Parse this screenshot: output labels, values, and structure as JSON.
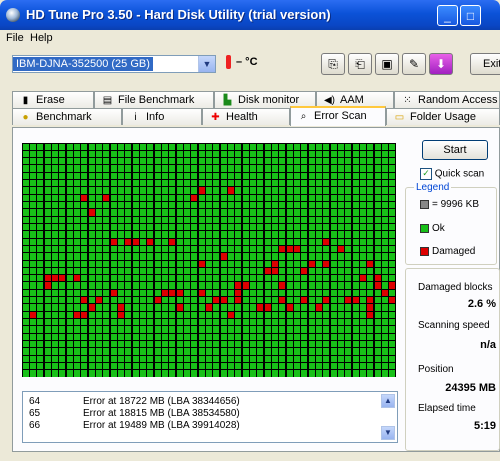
{
  "window": {
    "title": "HD Tune Pro 3.50 - Hard Disk Utility (trial version)",
    "menu": [
      "File",
      "Help"
    ]
  },
  "toolbar": {
    "drive": "IBM-DJNA-352500 (25 GB)",
    "temperature": "– °C",
    "exit_label": "Exit",
    "icons": [
      "copy-icon",
      "copy-all-icon",
      "save-icon",
      "options-icon",
      "download-icon"
    ]
  },
  "tabs_top": [
    {
      "label": "Erase",
      "icon": "trash-icon"
    },
    {
      "label": "File Benchmark",
      "icon": "file-benchmark-icon"
    },
    {
      "label": "Disk monitor",
      "icon": "disk-monitor-icon"
    },
    {
      "label": "AAM",
      "icon": "speaker-icon"
    },
    {
      "label": "Random Access",
      "icon": "random-access-icon"
    }
  ],
  "tabs_bottom": [
    {
      "label": "Benchmark",
      "icon": "benchmark-icon"
    },
    {
      "label": "Info",
      "icon": "info-icon"
    },
    {
      "label": "Health",
      "icon": "health-cross-icon"
    },
    {
      "label": "Error Scan",
      "icon": "magnifier-icon",
      "active": true
    },
    {
      "label": "Folder Usage",
      "icon": "folder-icon"
    }
  ],
  "controls": {
    "start_label": "Start",
    "quick_scan_label": "Quick scan",
    "quick_scan_checked": true
  },
  "legend": {
    "title": "Legend",
    "block_size": "= 9996 KB",
    "ok_label": "Ok",
    "damaged_label": "Damaged",
    "ok_color": "#18c018",
    "damaged_color": "#dd0000"
  },
  "stats": {
    "damaged_blocks_label": "Damaged blocks",
    "damaged_blocks_value": "2.6 %",
    "scanning_speed_label": "Scanning speed",
    "scanning_speed_value": "n/a",
    "position_label": "Position",
    "position_value": "24395 MB",
    "elapsed_label": "Elapsed time",
    "elapsed_value": "5:19"
  },
  "log": [
    {
      "num": "64",
      "text": "Error at 18722 MB (LBA 38344656)"
    },
    {
      "num": "65",
      "text": "Error at 18815 MB (LBA 38534580)"
    },
    {
      "num": "66",
      "text": "Error at 19489 MB (LBA 39914028)"
    }
  ],
  "scan_grid": {
    "cols": 51,
    "rows": 32,
    "damaged": [
      [
        11,
        7
      ],
      [
        9,
        9
      ],
      [
        24,
        6
      ],
      [
        8,
        7
      ],
      [
        23,
        7
      ],
      [
        28,
        6
      ],
      [
        12,
        13
      ],
      [
        14,
        13
      ],
      [
        15,
        13
      ],
      [
        17,
        13
      ],
      [
        20,
        13
      ],
      [
        41,
        13
      ],
      [
        35,
        14
      ],
      [
        36,
        14
      ],
      [
        37,
        14
      ],
      [
        43,
        14
      ],
      [
        47,
        16
      ],
      [
        41,
        16
      ],
      [
        33,
        17
      ],
      [
        34,
        17
      ],
      [
        38,
        17
      ],
      [
        39,
        16
      ],
      [
        24,
        16
      ],
      [
        27,
        15
      ],
      [
        3,
        18
      ],
      [
        4,
        18
      ],
      [
        5,
        18
      ],
      [
        7,
        18
      ],
      [
        3,
        19
      ],
      [
        29,
        19
      ],
      [
        30,
        19
      ],
      [
        48,
        19
      ],
      [
        34,
        16
      ],
      [
        35,
        19
      ],
      [
        46,
        18
      ],
      [
        48,
        18
      ],
      [
        50,
        19
      ],
      [
        12,
        20
      ],
      [
        19,
        20
      ],
      [
        20,
        20
      ],
      [
        21,
        20
      ],
      [
        24,
        20
      ],
      [
        29,
        20
      ],
      [
        49,
        20
      ],
      [
        8,
        21
      ],
      [
        10,
        21
      ],
      [
        9,
        22
      ],
      [
        18,
        21
      ],
      [
        26,
        21
      ],
      [
        27,
        21
      ],
      [
        29,
        21
      ],
      [
        35,
        21
      ],
      [
        38,
        21
      ],
      [
        41,
        21
      ],
      [
        44,
        21
      ],
      [
        45,
        21
      ],
      [
        47,
        21
      ],
      [
        50,
        21
      ],
      [
        13,
        22
      ],
      [
        21,
        22
      ],
      [
        25,
        22
      ],
      [
        32,
        22
      ],
      [
        33,
        22
      ],
      [
        36,
        22
      ],
      [
        40,
        22
      ],
      [
        47,
        22
      ],
      [
        1,
        23
      ],
      [
        7,
        23
      ],
      [
        8,
        23
      ],
      [
        13,
        23
      ],
      [
        28,
        23
      ],
      [
        47,
        23
      ]
    ]
  }
}
